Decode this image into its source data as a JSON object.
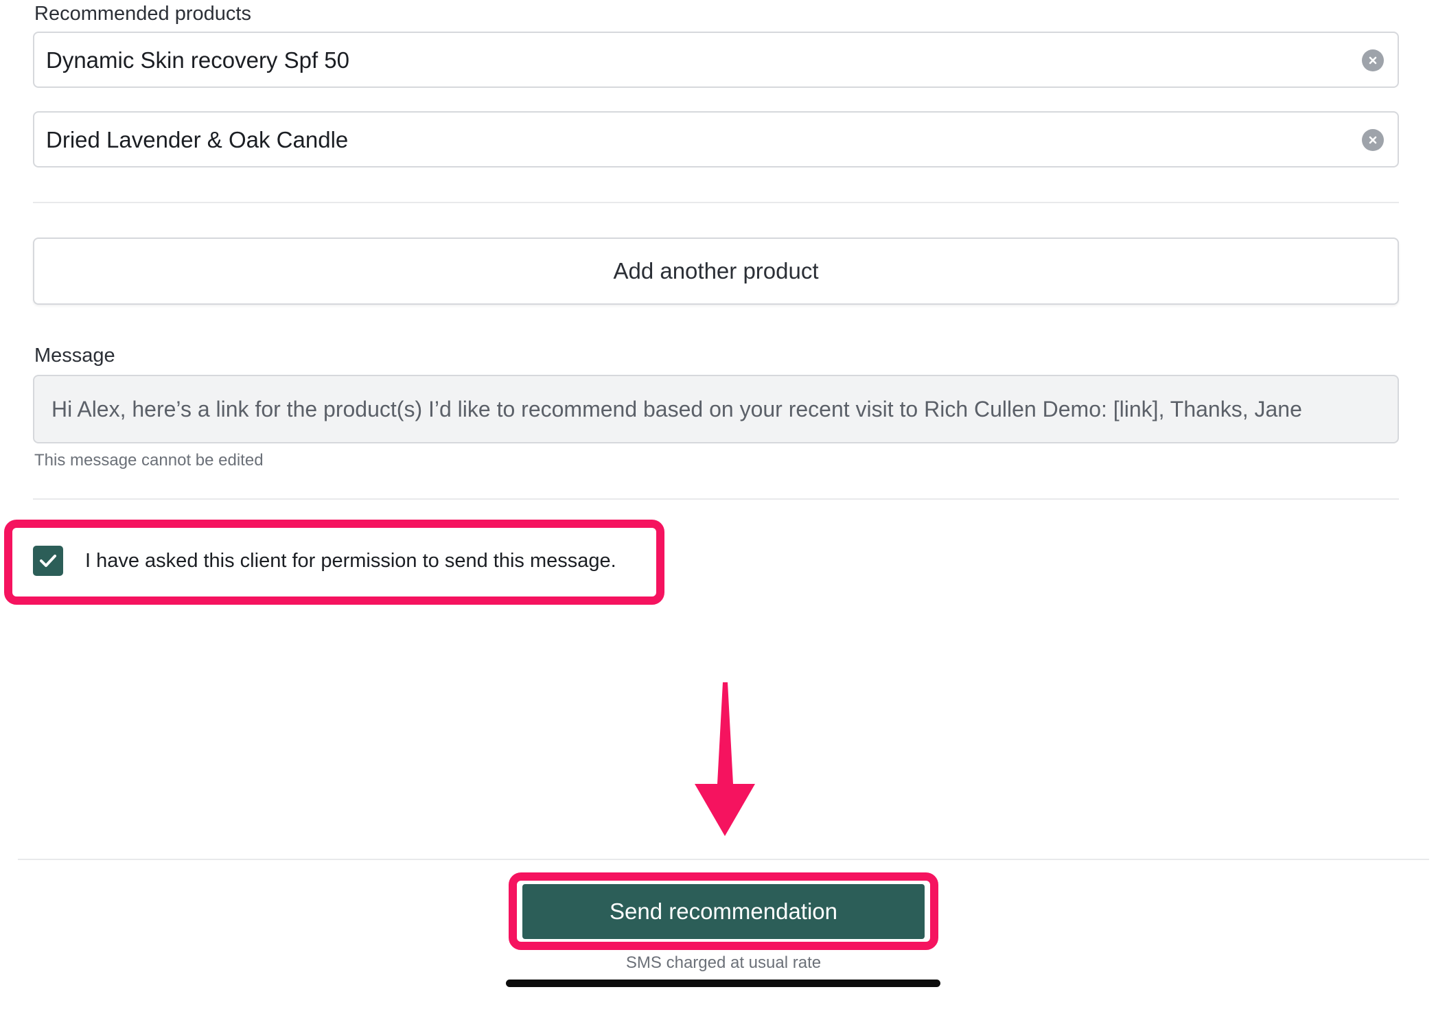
{
  "products": {
    "label": "Recommended products",
    "items": [
      {
        "name": "Dynamic Skin recovery Spf 50"
      },
      {
        "name": "Dried Lavender & Oak Candle"
      }
    ],
    "add_label": "Add another product"
  },
  "message": {
    "label": "Message",
    "text": "Hi Alex, here’s a link for the product(s) I’d like to recommend based on your recent visit to Rich Cullen Demo: [link], Thanks, Jane",
    "hint": "This message cannot be edited"
  },
  "consent": {
    "checked": true,
    "label": "I have asked this client for permission to send this message."
  },
  "footer": {
    "send_label": "Send recommendation",
    "note": "SMS charged at usual rate"
  },
  "colors": {
    "accent": "#2c5e58",
    "annotation": "#f5135f"
  },
  "icons": {
    "clear": "clear-circle-icon",
    "check": "checkmark-icon",
    "annotation_arrow": "down-arrow-icon"
  }
}
